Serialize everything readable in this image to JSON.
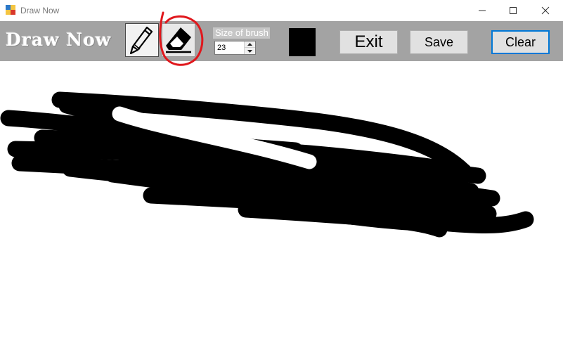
{
  "window": {
    "title": "Draw Now",
    "controls": [
      "minimize",
      "maximize",
      "close"
    ]
  },
  "toolbar": {
    "app_name": "Draw Now",
    "tools": [
      {
        "name": "pencil",
        "icon": "pencil-icon"
      },
      {
        "name": "eraser",
        "icon": "eraser-icon"
      }
    ],
    "size_label": "Size of brush",
    "size_value": "23",
    "brush_color": "#000000",
    "exit_label": "Exit",
    "save_label": "Save",
    "clear_label": "Clear"
  },
  "colors": {
    "toolbar_bg": "#a3a3a3",
    "annotation": "#e0171c",
    "clear_focus": "#0078d7",
    "ink": "#000000"
  }
}
